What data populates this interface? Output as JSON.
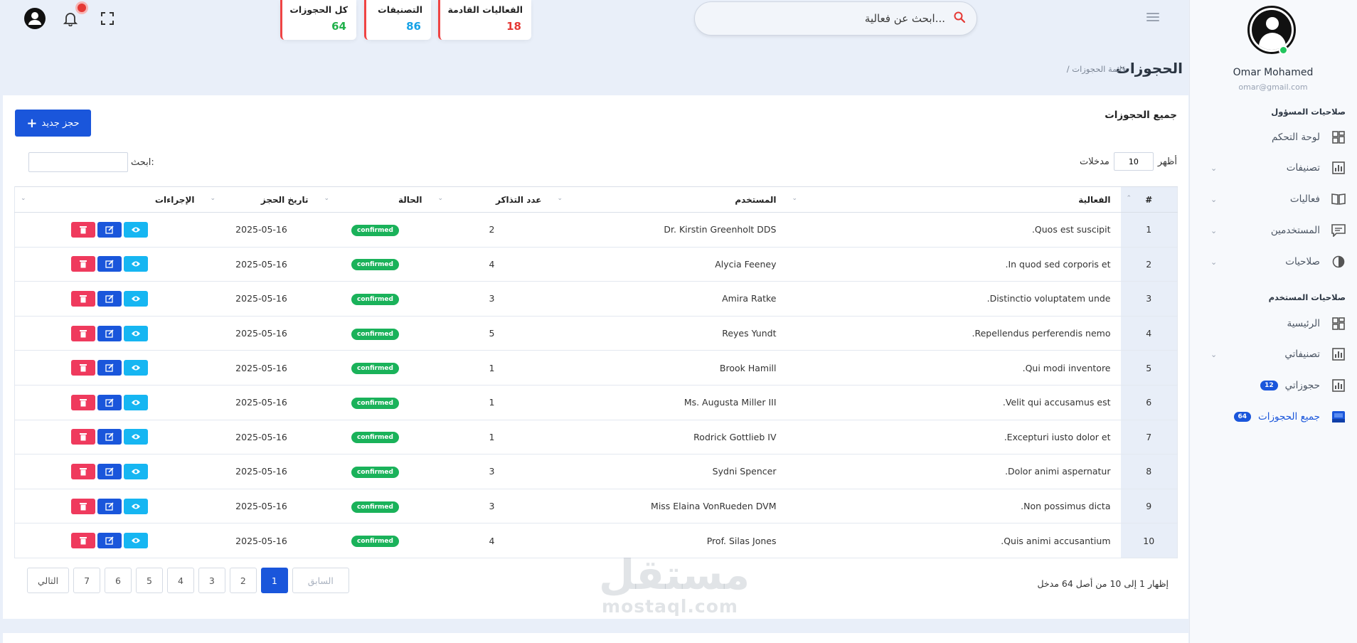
{
  "user": {
    "name": "Omar Mohamed",
    "email": "omar@gmail.com"
  },
  "sidebar": {
    "admin_section": "صلاحيات المسؤول",
    "admin_items": [
      {
        "label": "لوحة التحكم",
        "icon": "dashboard-icon"
      },
      {
        "label": "تصنيفات",
        "icon": "chart-icon"
      },
      {
        "label": "فعاليات",
        "icon": "book-icon"
      },
      {
        "label": "المستخدمين",
        "icon": "chat-icon"
      },
      {
        "label": "صلاحيات",
        "icon": "pie-icon"
      }
    ],
    "user_section": "صلاحيات المستخدم",
    "user_items": [
      {
        "label": "الرئيسية",
        "icon": "dashboard-icon"
      },
      {
        "label": "تصنيفاتي",
        "icon": "chart-icon"
      },
      {
        "label": "حجوزاتي",
        "icon": "chart-icon",
        "badge": "12"
      },
      {
        "label": "جميع الحجوزات",
        "icon": "inbox-icon",
        "badge": "64"
      }
    ]
  },
  "topbar": {
    "search_placeholder": "ابحث عن فعالية...",
    "stats": [
      {
        "title": "الفعاليات القادمة",
        "value": "18",
        "color": "#e53935"
      },
      {
        "title": "التصنيفات",
        "value": "86",
        "color": "#16a2e6"
      },
      {
        "title": "كل الحجوزات",
        "value": "64",
        "color": "#22b14c"
      }
    ]
  },
  "page": {
    "title": "الحجوزات",
    "breadcrumb": "/ قائمة الحجوزات"
  },
  "card": {
    "title": "جميع الحجوزات",
    "new_button": "حجز جديد",
    "length_before": "أظهر",
    "length_value": "10",
    "length_after": "مدخلات",
    "search_label": "ابحث:"
  },
  "table": {
    "headers": [
      "#",
      "الفعالية",
      "المستخدم",
      "عدد التذاكر",
      "الحالة",
      "تاريخ الحجز",
      "الإجراءات"
    ],
    "rows": [
      {
        "n": "1",
        "event": "Quos est suscipit.",
        "user": "Dr. Kirstin Greenholt DDS",
        "tickets": "2",
        "status": "confirmed",
        "date": "2025-05-16"
      },
      {
        "n": "2",
        "event": "In quod sed corporis et.",
        "user": "Alycia Feeney",
        "tickets": "4",
        "status": "confirmed",
        "date": "2025-05-16"
      },
      {
        "n": "3",
        "event": "Distinctio voluptatem unde.",
        "user": "Amira Ratke",
        "tickets": "3",
        "status": "confirmed",
        "date": "2025-05-16"
      },
      {
        "n": "4",
        "event": "Repellendus perferendis nemo.",
        "user": "Reyes Yundt",
        "tickets": "5",
        "status": "confirmed",
        "date": "2025-05-16"
      },
      {
        "n": "5",
        "event": "Qui modi inventore.",
        "user": "Brook Hamill",
        "tickets": "1",
        "status": "confirmed",
        "date": "2025-05-16"
      },
      {
        "n": "6",
        "event": "Velit qui accusamus est.",
        "user": "Ms. Augusta Miller III",
        "tickets": "1",
        "status": "confirmed",
        "date": "2025-05-16"
      },
      {
        "n": "7",
        "event": "Excepturi iusto dolor et.",
        "user": "Rodrick Gottlieb IV",
        "tickets": "1",
        "status": "confirmed",
        "date": "2025-05-16"
      },
      {
        "n": "8",
        "event": "Dolor animi aspernatur.",
        "user": "Sydni Spencer",
        "tickets": "3",
        "status": "confirmed",
        "date": "2025-05-16"
      },
      {
        "n": "9",
        "event": "Non possimus dicta.",
        "user": "Miss Elaina VonRueden DVM",
        "tickets": "3",
        "status": "confirmed",
        "date": "2025-05-16"
      },
      {
        "n": "10",
        "event": "Quis animi accusantium.",
        "user": "Prof. Silas Jones",
        "tickets": "4",
        "status": "confirmed",
        "date": "2025-05-16"
      }
    ]
  },
  "footer": {
    "info": "إظهار 1 إلى 10 من أصل 64 مدخل",
    "prev": "السابق",
    "next": "التالي",
    "pages": [
      "1",
      "2",
      "3",
      "4",
      "5",
      "6",
      "7"
    ]
  },
  "watermark": {
    "ar": "مستقل",
    "en": "mostaql.com"
  },
  "colors": {
    "primary": "#1a56db",
    "success": "#1ab25a",
    "danger": "#ef3a5d",
    "info": "#16b6f2"
  }
}
